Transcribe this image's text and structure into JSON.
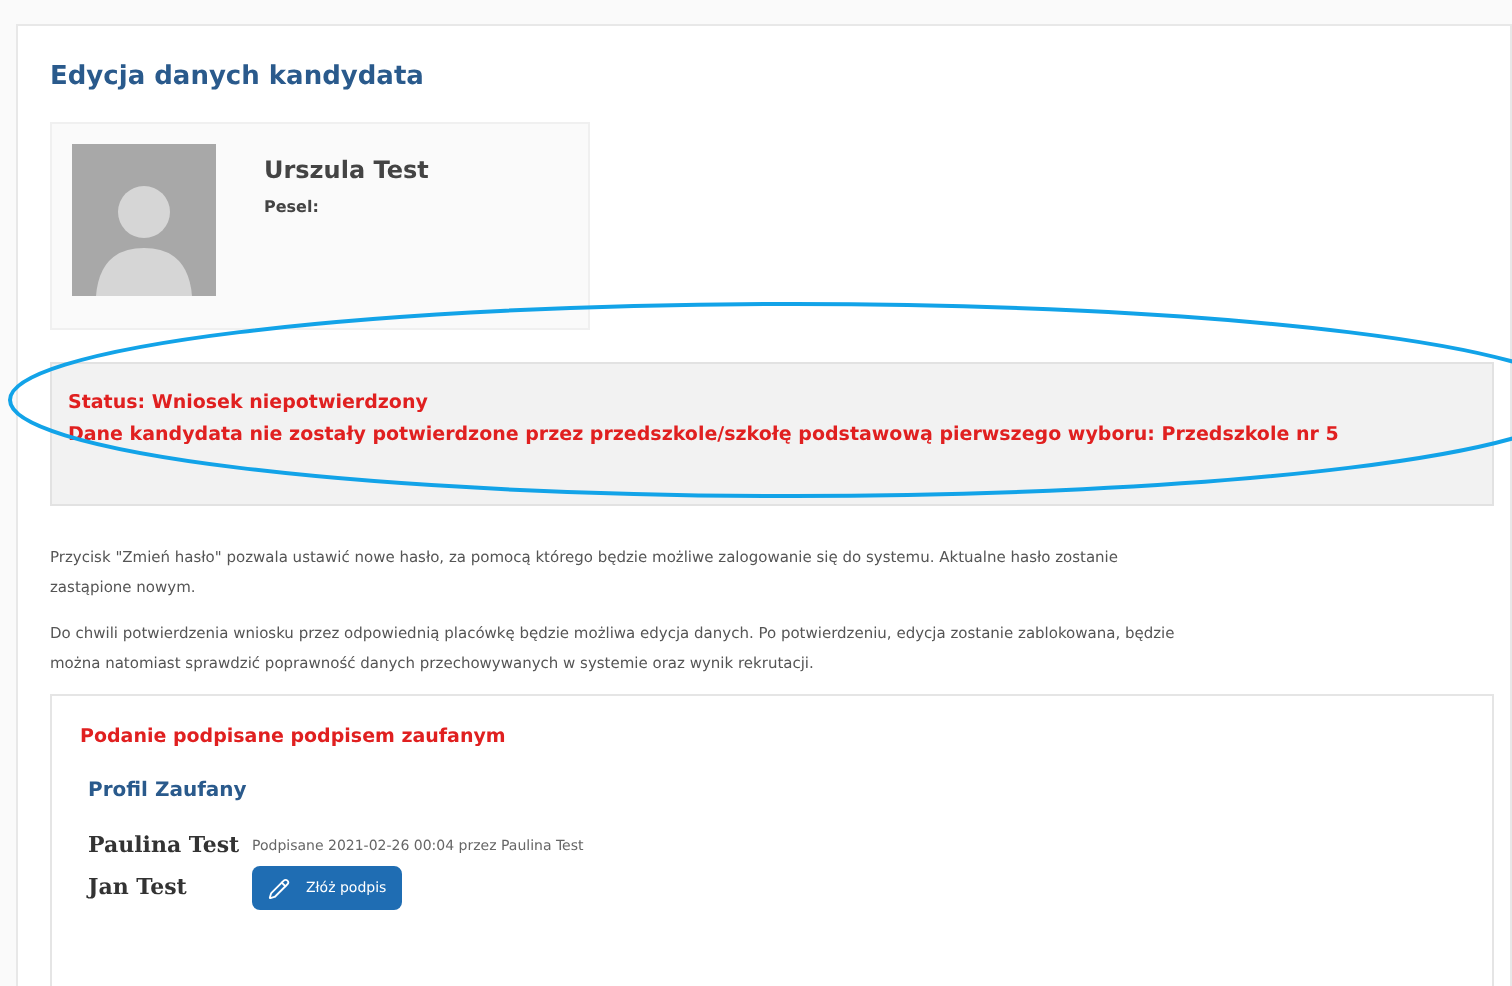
{
  "page_title": "Edycja danych kandydata",
  "candidate": {
    "name": "Urszula Test",
    "pesel_label": "Pesel:"
  },
  "status": {
    "lines": [
      "Status: Wniosek niepotwierdzony",
      "Dane kandydata nie zostały potwierdzone przez przedszkole/szkołę podstawową pierwszego wyboru: Przedszkole nr 5"
    ]
  },
  "paragraphs": [
    "Przycisk \"Zmień hasło\" pozwala ustawić nowe hasło, za pomocą którego będzie możliwe zalogowanie się do systemu. Aktualne hasło zostanie zastąpione nowym.",
    "Do chwili potwierdzenia wniosku przez odpowiednią placówkę będzie możliwa edycja danych. Po potwierdzeniu, edycja zostanie zablokowana, będzie można natomiast sprawdzić poprawność danych przechowywanych w systemie oraz wynik rekrutacji."
  ],
  "signature": {
    "heading": "Podanie podpisane podpisem zaufanym",
    "subheading": "Profil Zaufany",
    "signers": [
      {
        "name": "Paulina Test",
        "kind": "signed",
        "note": "Podpisane 2021-02-26 00:04 przez Paulina Test"
      },
      {
        "name": "Jan Test",
        "kind": "unsigned",
        "button": "Złóż podpis"
      }
    ]
  }
}
